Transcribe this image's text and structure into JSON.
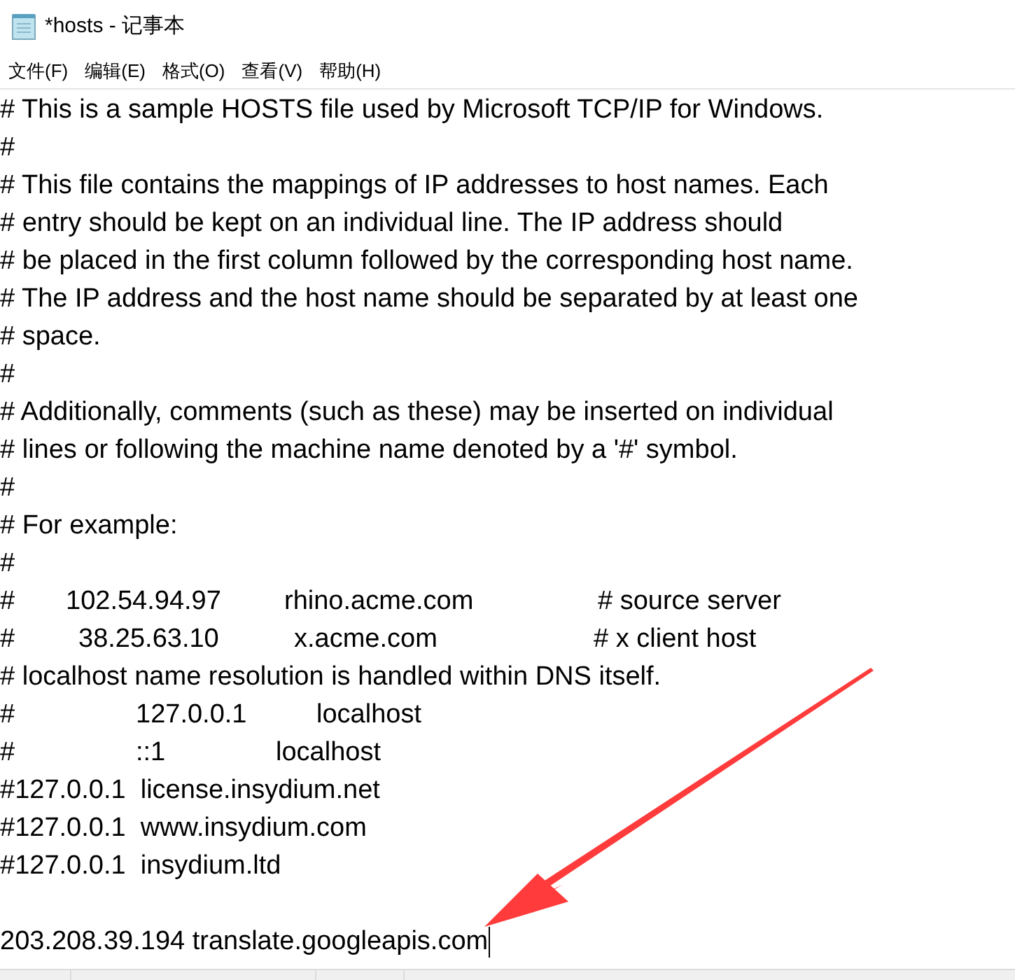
{
  "window": {
    "title": "*hosts - 记事本"
  },
  "menu": [
    "文件(F)",
    "编辑(E)",
    "格式(O)",
    "查看(V)",
    "帮助(H)"
  ],
  "editor": {
    "lines": [
      {
        "kind": "text",
        "text": "# This is a sample HOSTS file used by Microsoft TCP/IP for Windows."
      },
      {
        "kind": "text",
        "text": "#"
      },
      {
        "kind": "text",
        "text": "# This file contains the mappings of IP addresses to host names. Each"
      },
      {
        "kind": "text",
        "text": "# entry should be kept on an individual line. The IP address should"
      },
      {
        "kind": "text",
        "text": "# be placed in the first column followed by the corresponding host name."
      },
      {
        "kind": "text",
        "text": "# The IP address and the host name should be separated by at least one"
      },
      {
        "kind": "text",
        "text": "# space."
      },
      {
        "kind": "text",
        "text": "#"
      },
      {
        "kind": "text",
        "text": "# Additionally, comments (such as these) may be inserted on individual"
      },
      {
        "kind": "text",
        "text": "# lines or following the machine name denoted by a '#' symbol."
      },
      {
        "kind": "text",
        "text": "#"
      },
      {
        "kind": "text",
        "text": "# For example:"
      },
      {
        "kind": "text",
        "text": "#"
      },
      {
        "kind": "columns",
        "cells": [
          "#",
          "102.54.94.97",
          "rhino.acme.com",
          "# source server"
        ]
      },
      {
        "kind": "columns",
        "cells": [
          "#",
          "38.25.63.10",
          "x.acme.com",
          "# x client host"
        ]
      },
      {
        "kind": "text",
        "text": "# localhost name resolution is handled within DNS itself."
      },
      {
        "kind": "columns",
        "cells": [
          "#",
          "127.0.0.1",
          "localhost"
        ]
      },
      {
        "kind": "columns",
        "cells": [
          "#",
          "::1",
          "localhost"
        ]
      },
      {
        "kind": "text",
        "text": "#127.0.0.1  license.insydium.net"
      },
      {
        "kind": "text",
        "text": "#127.0.0.1  www.insydium.com"
      },
      {
        "kind": "text",
        "text": "#127.0.0.1  insydium.ltd"
      },
      {
        "kind": "blank"
      },
      {
        "kind": "text",
        "text": "203.208.39.194 translate.googleapis.com",
        "caret": true
      }
    ]
  }
}
